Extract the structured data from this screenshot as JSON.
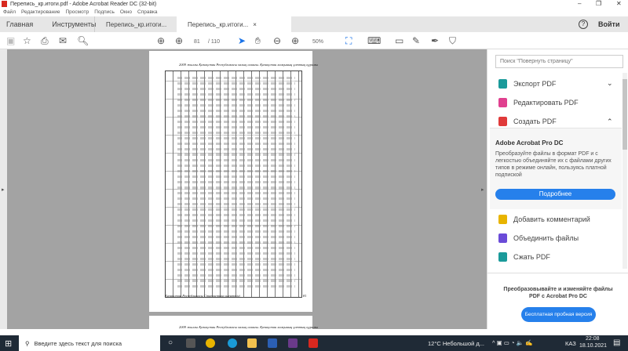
{
  "window": {
    "title": "Перепись_кр.итоги.pdf - Adobe Acrobat Reader DC (32-bit)",
    "minimize": "–",
    "restore": "❐",
    "close": "✕"
  },
  "menu": [
    "Файл",
    "Редактирование",
    "Просмотр",
    "Подпись",
    "Окно",
    "Справка"
  ],
  "tabs": {
    "home": "Главная",
    "tools": "Инструменты",
    "doc1": "Перепись_кр.итоги...",
    "doc2": "Перепись_кр.итоги...",
    "close": "×",
    "help": "?",
    "signin": "Войти"
  },
  "toolbar": {
    "page_current": "81",
    "page_total": "/ 110",
    "zoom": "50%"
  },
  "page": {
    "header": "2009 жылғы Қазақстан Республикасы халық санағы. Қазақстан халқының ұлттық құрамы",
    "footer_left": "Қазақстан Республикасы Статистика агенттігі",
    "page_number": "81",
    "next_header": "2009 жылғы Қазақстан Республикасы халық санағы. Қазақстан халқының ұлттық құрамы"
  },
  "panel": {
    "search_placeholder": "Поиск \"Повернуть страницу\"",
    "tools": [
      {
        "label": "Экспорт PDF",
        "color": "#1a9a9a"
      },
      {
        "label": "Редактировать PDF",
        "color": "#e0408f"
      },
      {
        "label": "Создать PDF",
        "color": "#e03a3a"
      }
    ],
    "promo_title": "Adobe Acrobat Pro DC",
    "promo_text": "Преобразуйте файлы в формат PDF и с легкостью объединяйте их с файлами других типов в режиме онлайн, пользуясь платной подпиской",
    "promo_button": "Подробнее",
    "tools2": [
      {
        "label": "Добавить комментарий",
        "color": "#e8b400"
      },
      {
        "label": "Объединить файлы",
        "color": "#6a4bd8"
      },
      {
        "label": "Сжать PDF",
        "color": "#1a9a9a"
      }
    ],
    "bottom_text": "Преобразовывайте и изменяйте файлы PDF с Acrobat Pro DC",
    "trial_button": "Бесплатная пробная версия",
    "accent": "#2680eb"
  },
  "taskbar": {
    "search": "Введите здесь текст для поиска",
    "weather": "12°C  Небольшой д...",
    "lang": "КАЗ",
    "time": "22:08",
    "date": "18.10.2021"
  }
}
